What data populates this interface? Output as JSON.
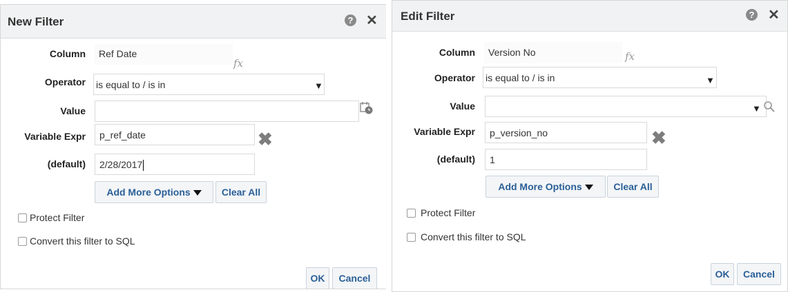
{
  "new_filter": {
    "title": "New Filter",
    "help_glyph": "?",
    "close_glyph": "✕",
    "column_label": "Column",
    "column_value": "Ref Date",
    "fx_glyph": "fx",
    "operator_label": "Operator",
    "operator_value": "is equal to / is in",
    "value_label": "Value",
    "value_value": "",
    "variable_expr_label": "Variable Expr",
    "variable_expr_value": "p_ref_date",
    "default_label": "(default)",
    "default_value": "2/28/2017",
    "add_more_options": "Add More Options",
    "clear_all": "Clear All",
    "protect_filter": "Protect Filter",
    "convert_sql": "Convert this filter to SQL",
    "ok": "OK",
    "cancel": "Cancel"
  },
  "edit_filter": {
    "title": "Edit Filter",
    "help_glyph": "?",
    "close_glyph": "✕",
    "column_label": "Column",
    "column_value": "Version No",
    "fx_glyph": "fx",
    "operator_label": "Operator",
    "operator_value": "is equal to / is in",
    "value_label": "Value",
    "value_value": "",
    "variable_expr_label": "Variable Expr",
    "variable_expr_value": "p_version_no",
    "default_label": "(default)",
    "default_value": "1",
    "add_more_options": "Add More Options",
    "clear_all": "Clear All",
    "protect_filter": "Protect Filter",
    "convert_sql": "Convert this filter to SQL",
    "ok": "OK",
    "cancel": "Cancel"
  },
  "icons": {
    "help": "help-icon",
    "close": "close-icon",
    "fx": "fx-icon",
    "dropdown": "dropdown-arrow-icon",
    "calendar": "calendar-icon",
    "clear": "clear-x-icon",
    "search": "search-icon"
  },
  "colors": {
    "titlebar_bg": "#f1f2f3",
    "button_text": "#2a5f97",
    "button_bg": "#f3f5f7"
  }
}
